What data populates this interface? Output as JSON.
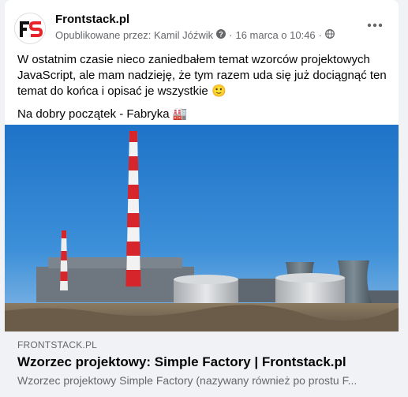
{
  "post": {
    "page_name": "Frontstack.pl",
    "avatar_text": "FS",
    "meta_author": "Opublikowane przez: Kamil Jóźwik",
    "meta_date": "16 marca o 10:46",
    "meta_separator": "·",
    "more_label": "•••",
    "paragraph1": "W ostatnim czasie nieco zaniedbałem temat wzorców projektowych JavaScript, ale mam nadzieję, że tym razem uda się już dociągnąć ten temat do końca i opisać je wszystkie 🙂",
    "paragraph2": "Na dobry początek - Fabryka 🏭"
  },
  "link_preview": {
    "domain": "FRONTSTACK.PL",
    "title": "Wzorzec projektowy: Simple Factory | Frontstack.pl",
    "description": "Wzorzec projektowy Simple Factory (nazywany również po prostu F..."
  },
  "icons": {
    "help": "question-circle-icon",
    "audience": "globe-icon",
    "more": "more-horizontal-icon"
  },
  "colors": {
    "brand_red": "#e8232a",
    "text_primary": "#050505",
    "text_secondary": "#65676b",
    "link_bg": "#f0f2f5"
  }
}
